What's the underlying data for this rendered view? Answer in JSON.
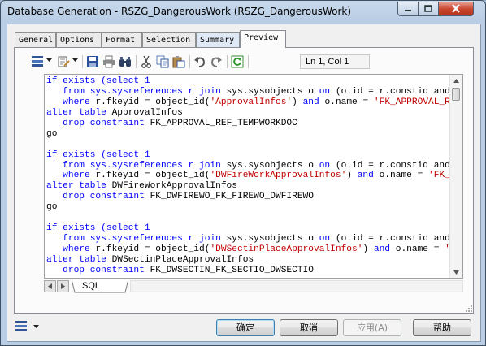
{
  "window": {
    "title": "Database Generation - RSZG_DangerousWork (RSZG_DangerousWork)"
  },
  "tabs": [
    {
      "label": "General"
    },
    {
      "label": "Options"
    },
    {
      "label": "Format"
    },
    {
      "label": "Selection"
    },
    {
      "label": "Summary"
    },
    {
      "label": "Preview"
    }
  ],
  "active_tab": "Preview",
  "toolbar": {
    "icons": [
      "script-icon",
      "properties-icon",
      "save-icon",
      "print-icon",
      "find-icon",
      "cut-icon",
      "copy-icon",
      "paste-icon",
      "undo-icon",
      "redo-icon",
      "refresh-icon"
    ],
    "cursor_position": "Ln 1, Col 1"
  },
  "editor": {
    "lines": [
      [
        {
          "t": "if exists ",
          "c": "kw"
        },
        {
          "t": "(select 1",
          "c": "kw"
        }
      ],
      [
        {
          "t": "   from sys.sysreferences r ",
          "c": "kw"
        },
        {
          "t": "join",
          "c": "kw"
        },
        {
          "t": " sys.sysobjects o ",
          "c": ""
        },
        {
          "t": "on",
          "c": "kw"
        },
        {
          "t": " (o.id = r.constid and o.type = 'F')",
          "c": ""
        }
      ],
      [
        {
          "t": "   where ",
          "c": "kw"
        },
        {
          "t": "r.fkeyid = object_id(",
          "c": ""
        },
        {
          "t": "'ApprovalInfos'",
          "c": "str"
        },
        {
          "t": ") ",
          "c": ""
        },
        {
          "t": "and",
          "c": "kw"
        },
        {
          "t": " o.name = ",
          "c": ""
        },
        {
          "t": "'FK_APPROVAL_REF_TEMPWORKDOC'",
          "c": "str"
        },
        {
          "t": ")",
          "c": ""
        }
      ],
      [
        {
          "t": "alter table",
          "c": "kw"
        },
        {
          "t": " ApprovalInfos",
          "c": ""
        }
      ],
      [
        {
          "t": "   drop constraint",
          "c": "kw"
        },
        {
          "t": " FK_APPROVAL_REF_TEMPWORKDOC",
          "c": ""
        }
      ],
      [
        {
          "t": "go",
          "c": ""
        }
      ],
      [],
      [
        {
          "t": "if exists ",
          "c": "kw"
        },
        {
          "t": "(select 1",
          "c": "kw"
        }
      ],
      [
        {
          "t": "   from sys.sysreferences r ",
          "c": "kw"
        },
        {
          "t": "join",
          "c": "kw"
        },
        {
          "t": " sys.sysobjects o ",
          "c": ""
        },
        {
          "t": "on",
          "c": "kw"
        },
        {
          "t": " (o.id = r.constid and o.type = 'F')",
          "c": ""
        }
      ],
      [
        {
          "t": "   where ",
          "c": "kw"
        },
        {
          "t": "r.fkeyid = object_id(",
          "c": ""
        },
        {
          "t": "'DWFireWorkApprovalInfos'",
          "c": "str"
        },
        {
          "t": ") ",
          "c": ""
        },
        {
          "t": "and",
          "c": "kw"
        },
        {
          "t": " o.name = ",
          "c": ""
        },
        {
          "t": "'FK_DWFIREWO_FK_FIREWO_DWFIREWO'",
          "c": "str"
        },
        {
          "t": ")",
          "c": ""
        }
      ],
      [
        {
          "t": "alter table",
          "c": "kw"
        },
        {
          "t": " DWFireWorkApprovalInfos",
          "c": ""
        }
      ],
      [
        {
          "t": "   drop constraint",
          "c": "kw"
        },
        {
          "t": " FK_DWFIREWO_FK_FIREWO_DWFIREWO",
          "c": ""
        }
      ],
      [
        {
          "t": "go",
          "c": ""
        }
      ],
      [],
      [
        {
          "t": "if exists ",
          "c": "kw"
        },
        {
          "t": "(select 1",
          "c": "kw"
        }
      ],
      [
        {
          "t": "   from sys.sysreferences r ",
          "c": "kw"
        },
        {
          "t": "join",
          "c": "kw"
        },
        {
          "t": " sys.sysobjects o ",
          "c": ""
        },
        {
          "t": "on",
          "c": "kw"
        },
        {
          "t": " (o.id = r.constid and o.type = 'F')",
          "c": ""
        }
      ],
      [
        {
          "t": "   where ",
          "c": "kw"
        },
        {
          "t": "r.fkeyid = object_id(",
          "c": ""
        },
        {
          "t": "'DWSectinPlaceApprovalInfos'",
          "c": "str"
        },
        {
          "t": ") ",
          "c": ""
        },
        {
          "t": "and",
          "c": "kw"
        },
        {
          "t": " o.name = ",
          "c": ""
        },
        {
          "t": "'FK_DWSECTIN_FK_SECTIO_DWSECTIO'",
          "c": "str"
        },
        {
          "t": ")",
          "c": ""
        }
      ],
      [
        {
          "t": "alter table",
          "c": "kw"
        },
        {
          "t": " DWSectinPlaceApprovalInfos",
          "c": ""
        }
      ],
      [
        {
          "t": "   drop constraint",
          "c": "kw"
        },
        {
          "t": " FK_DWSECTIN_FK_SECTIO_DWSECTIO",
          "c": ""
        }
      ],
      [
        {
          "t": "go",
          "c": ""
        }
      ]
    ],
    "sheet_tab": "SQL"
  },
  "buttons": {
    "ok": "确定",
    "cancel": "取消",
    "apply": "应用(A)",
    "help": "帮助"
  },
  "colors": {
    "keyword": "#0000ff",
    "string": "#c00000",
    "close_button": "#c8442c"
  }
}
